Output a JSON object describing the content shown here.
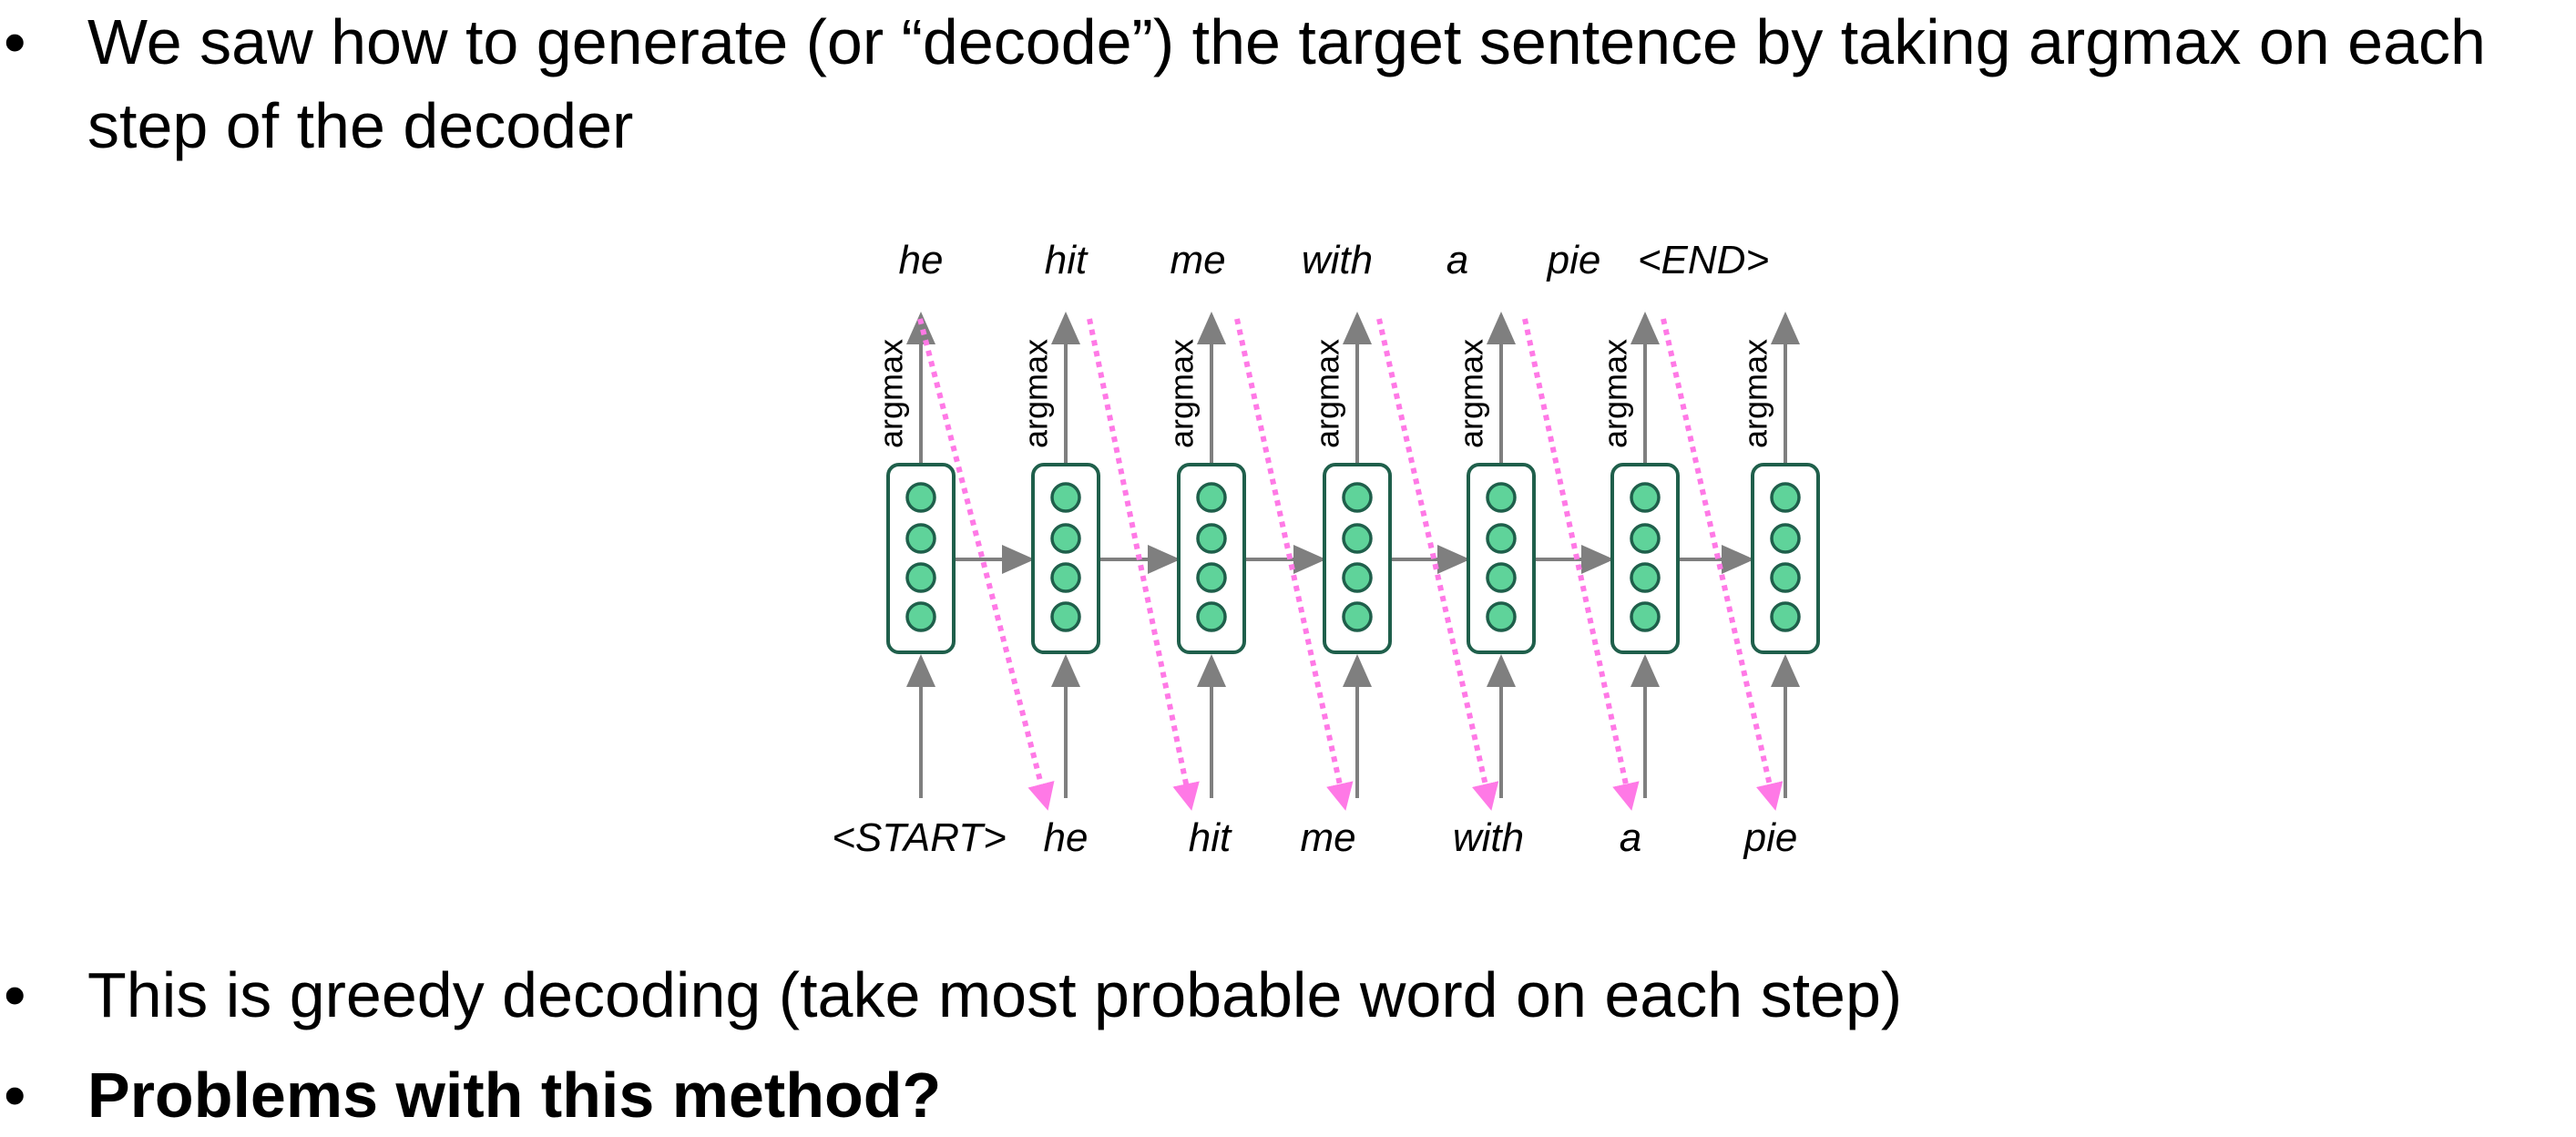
{
  "slide": {
    "bullet_symbol": "•",
    "bullets": [
      "We saw how to generate (or “decode”) the target sentence by taking argmax on each step of the decoder",
      "This is greedy decoding (take most probable word on each step)",
      "Problems with this method?"
    ]
  },
  "diagram": {
    "node_label": "argmax",
    "output_words": [
      "he",
      "hit",
      "me",
      "with",
      "a",
      "pie",
      "<END>"
    ],
    "input_words": [
      "<START>",
      "he",
      "hit",
      "me",
      "with",
      "a",
      "pie"
    ],
    "neurons_per_cell": 4,
    "colors": {
      "cell_border": "#1f5f4b",
      "neuron_fill": "#5fd39a",
      "neuron_stroke": "#1f5f4b",
      "arrow": "#7f7f7f",
      "feedback_arrow": "#ff79e6"
    }
  }
}
